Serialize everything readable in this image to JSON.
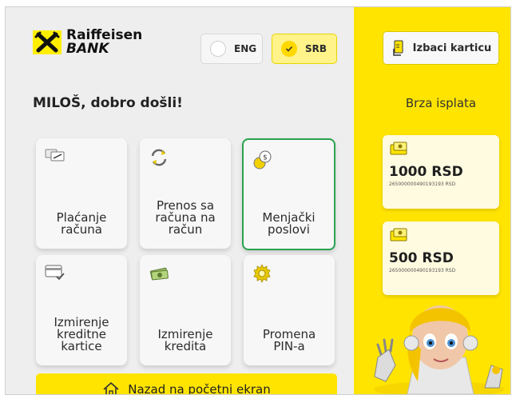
{
  "bank": {
    "logo_line1": "Raiffeisen",
    "logo_line2": "BANK"
  },
  "language": {
    "eng_label": "ENG",
    "srb_label": "SRB",
    "selected": "SRB"
  },
  "greeting": "MILOŠ, dobro došli!",
  "tiles": [
    {
      "label": "Plaćanje\nračuna",
      "icon": "bill-payment-icon"
    },
    {
      "label": "Prenos sa\nračuna na\nračun",
      "icon": "account-transfer-icon"
    },
    {
      "label": "Menjački\nposlovi",
      "icon": "currency-exchange-icon",
      "selected": true
    },
    {
      "label": "Izmirenje\nkreditne\nkartice",
      "icon": "credit-card-icon"
    },
    {
      "label": "Izmirenje\nkredita",
      "icon": "loan-cash-icon"
    },
    {
      "label": "Promena\nPIN-a",
      "icon": "gear-icon"
    }
  ],
  "home_button": {
    "label": "Nazad na početni ekran",
    "icon": "home-icon"
  },
  "eject_button": {
    "label": "Izbaci karticu",
    "icon": "card-eject-icon"
  },
  "quick_cash": {
    "title": "Brza isplata",
    "items": [
      {
        "amount": "1000 RSD",
        "account": "2650000004901931​93 RSD"
      },
      {
        "amount": "500 RSD",
        "account": "265000000490193193 RSD"
      }
    ]
  },
  "colors": {
    "accent_yellow": "#ffe400",
    "selected_border": "#2aa24e",
    "panel_grey": "#eeeeee"
  }
}
